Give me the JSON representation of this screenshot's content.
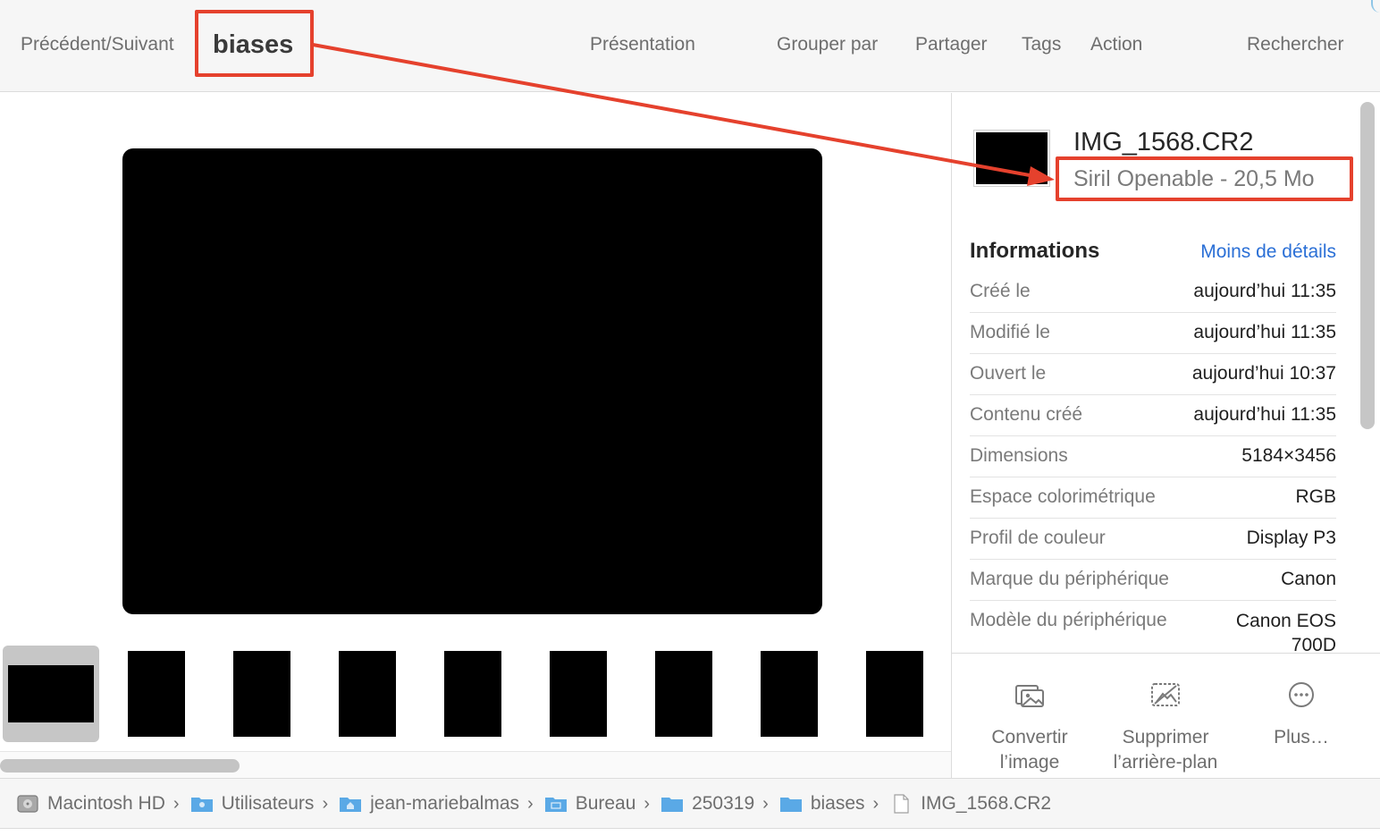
{
  "toolbar": {
    "nav_label": "Précédent/Suivant",
    "title": "biases",
    "presentation": "Présentation",
    "group_by": "Grouper par",
    "share": "Partager",
    "tags": "Tags",
    "action": "Action",
    "search": "Rechercher"
  },
  "inspector": {
    "file_name": "IMG_1568.CR2",
    "file_kind_size": "Siril Openable - 20,5 Mo",
    "info_title": "Informations",
    "less_details": "Moins de détails",
    "rows": [
      {
        "key": "Créé le",
        "value": "aujourd’hui 11:35"
      },
      {
        "key": "Modifié le",
        "value": "aujourd’hui 11:35"
      },
      {
        "key": "Ouvert le",
        "value": "aujourd’hui 10:37"
      },
      {
        "key": "Contenu créé",
        "value": "aujourd’hui 11:35"
      },
      {
        "key": "Dimensions",
        "value": "5184×3456"
      },
      {
        "key": "Espace colorimétrique",
        "value": "RGB"
      },
      {
        "key": "Profil de couleur",
        "value": "Display P3"
      },
      {
        "key": "Marque du périphérique",
        "value": "Canon"
      },
      {
        "key": "Modèle du périphérique",
        "value": "Canon EOS 700D"
      }
    ],
    "actions": {
      "convert_1": "Convertir",
      "convert_2": "l’image",
      "remove_bg_1": "Supprimer",
      "remove_bg_2": "l’arrière-plan",
      "more": "Plus…"
    }
  },
  "path": {
    "items": [
      "Macintosh HD",
      "Utilisateurs",
      "jean-mariebalmas",
      "Bureau",
      "250319",
      "biases",
      "IMG_1568.CR2"
    ]
  },
  "icons": {
    "disk": "hard-disk-icon",
    "user_folder": "user-folder-icon",
    "home_folder": "home-folder-icon",
    "desktop_folder": "desktop-folder-icon",
    "folder": "folder-icon",
    "file": "document-icon",
    "convert": "photo-convert-icon",
    "remove_bg": "remove-background-icon",
    "more": "ellipsis-circle-icon"
  },
  "colors": {
    "annotation": "#e5412d",
    "link": "#2a6fd6",
    "folder": "#5aa9e6"
  }
}
